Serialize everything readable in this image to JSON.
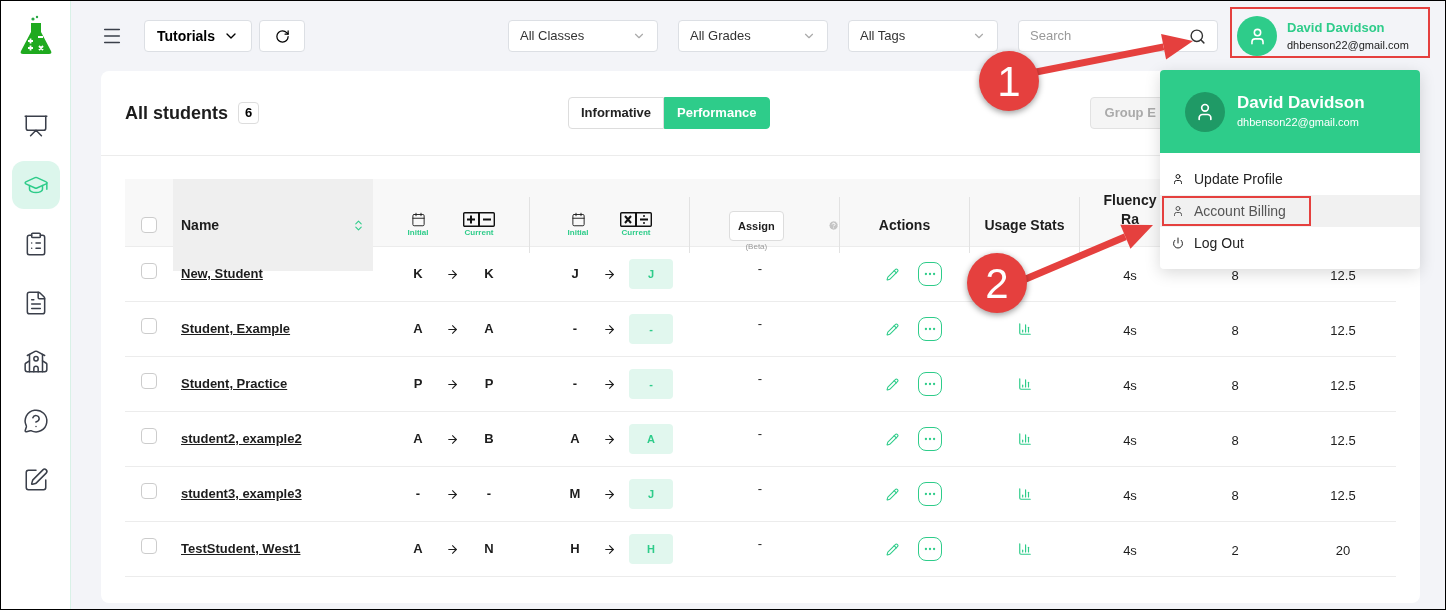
{
  "sidebar": {
    "items": [
      {
        "kind": "presentation",
        "selected": false
      },
      {
        "kind": "students",
        "selected": true
      },
      {
        "kind": "board",
        "selected": false
      },
      {
        "kind": "report",
        "selected": false
      },
      {
        "kind": "classroom",
        "selected": false
      },
      {
        "kind": "questions",
        "selected": false
      },
      {
        "kind": "edit",
        "selected": false
      }
    ]
  },
  "toolbar": {
    "tutorials": "Tutorials",
    "filters": [
      "All Classes",
      "All Grades",
      "All Tags"
    ],
    "search": {
      "placeholder": "Search"
    }
  },
  "user": {
    "name": "David Davidson",
    "email": "dhbenson22@gmail.com"
  },
  "card": {
    "title": "All students",
    "count": "6",
    "view_toggle": [
      {
        "label": "Informative",
        "selected": false
      },
      {
        "label": "Performance",
        "selected": true
      }
    ],
    "group_button": "Group E"
  },
  "table": {
    "select_all": {
      "checked": false
    },
    "columns": {
      "name": "Name",
      "add_initial": "Initial",
      "add_current": "Current",
      "mult_initial": "Initial",
      "mult_current": "Current",
      "assign": "Assign",
      "assign_note": "(Beta)",
      "actions": "Actions",
      "usage": "Usage Stats",
      "fluency": "Fluency Ra"
    },
    "rows": [
      {
        "checked": false,
        "name": "New, Student",
        "add_initial": "K",
        "add_current": "K",
        "mult_initial": "J",
        "mult_current": "J",
        "assign": "-",
        "stats_shown": false,
        "fluency": "4s",
        "column_9": "8",
        "column_10": "12.5"
      },
      {
        "checked": false,
        "name": "Student, Example",
        "add_initial": "A",
        "add_current": "A",
        "mult_initial": "-",
        "mult_current": "-",
        "assign": "-",
        "stats_shown": true,
        "fluency": "4s",
        "column_9": "8",
        "column_10": "12.5"
      },
      {
        "checked": false,
        "name": "Student, Practice",
        "add_initial": "P",
        "add_current": "P",
        "mult_initial": "-",
        "mult_current": "-",
        "assign": "-",
        "stats_shown": true,
        "fluency": "4s",
        "column_9": "8",
        "column_10": "12.5"
      },
      {
        "checked": false,
        "name": "student2, example2",
        "add_initial": "A",
        "add_current": "B",
        "mult_initial": "A",
        "mult_current": "A",
        "assign": "-",
        "stats_shown": true,
        "fluency": "4s",
        "column_9": "8",
        "column_10": "12.5"
      },
      {
        "checked": false,
        "name": "student3, example3",
        "add_initial": "-",
        "add_current": "-",
        "mult_initial": "M",
        "mult_current": "J",
        "assign": "-",
        "stats_shown": true,
        "fluency": "4s",
        "column_9": "8",
        "column_10": "12.5"
      },
      {
        "checked": false,
        "name": "TestStudent, West1",
        "add_initial": "A",
        "add_current": "N",
        "mult_initial": "H",
        "mult_current": "H",
        "assign": "-",
        "stats_shown": true,
        "fluency": "4s",
        "column_9": "2",
        "column_10": "20"
      }
    ]
  },
  "menu": {
    "name": "David Davidson",
    "email": "dhbenson22@gmail.com",
    "items": [
      {
        "label": "Update Profile",
        "kind": "profile",
        "selected": false
      },
      {
        "label": "Account Billing",
        "kind": "profile",
        "selected": true
      },
      {
        "label": "Log Out",
        "kind": "logout",
        "selected": false
      }
    ]
  },
  "annotations": [
    {
      "label": "1"
    },
    {
      "label": "2"
    }
  ]
}
